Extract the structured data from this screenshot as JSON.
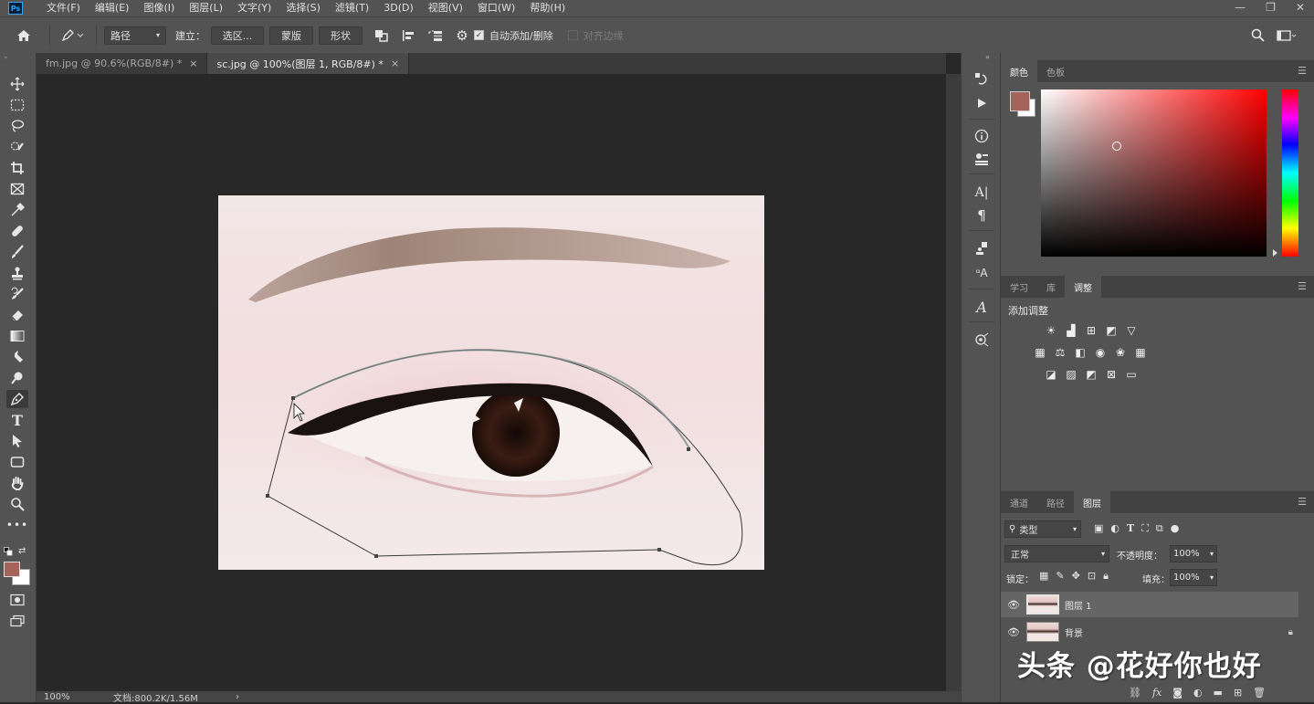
{
  "app": {
    "logo": "Ps",
    "menu": [
      "文件(F)",
      "编辑(E)",
      "图像(I)",
      "图层(L)",
      "文字(Y)",
      "选择(S)",
      "滤镜(T)",
      "3D(D)",
      "视图(V)",
      "窗口(W)",
      "帮助(H)"
    ],
    "window_controls": [
      "—",
      "❐",
      "✕"
    ]
  },
  "options_bar": {
    "mode_value": "路径",
    "make_label": "建立：",
    "selection_btn": "选区...",
    "mask_btn": "蒙版",
    "shape_btn": "形状",
    "auto_add_delete": "自动添加/删除",
    "align_edges": "对齐边缘"
  },
  "tabs": [
    {
      "label": "fm.jpg @ 90.6%(RGB/8#) *",
      "close": "×",
      "active": false
    },
    {
      "label": "sc.jpg @ 100%(图层 1, RGB/8#) *",
      "close": "×",
      "active": true
    }
  ],
  "status": {
    "zoom": "100%",
    "doc": "文档:800.2K/1.56M",
    "arrow": "›"
  },
  "color_panel": {
    "tabs": [
      "颜色",
      "色板"
    ],
    "foreground": "#a4645c",
    "background": "#ffffff"
  },
  "adjust_panel": {
    "tabs": [
      "学习",
      "库",
      "调整"
    ],
    "title": "添加调整"
  },
  "layers_panel": {
    "tabs": [
      "通道",
      "路径",
      "图层"
    ],
    "filter_label": "类型",
    "blend_mode": "正常",
    "opacity_label": "不透明度：",
    "opacity_value": "100%",
    "lock_label": "锁定：",
    "fill_label": "填充：",
    "fill_value": "100%",
    "layers": [
      {
        "name": "图层 1",
        "selected": true,
        "locked": false
      },
      {
        "name": "背景",
        "selected": false,
        "locked": true
      }
    ]
  },
  "watermark": "头条 @花好你也好",
  "colors": {
    "accent": "#31a8ff"
  }
}
